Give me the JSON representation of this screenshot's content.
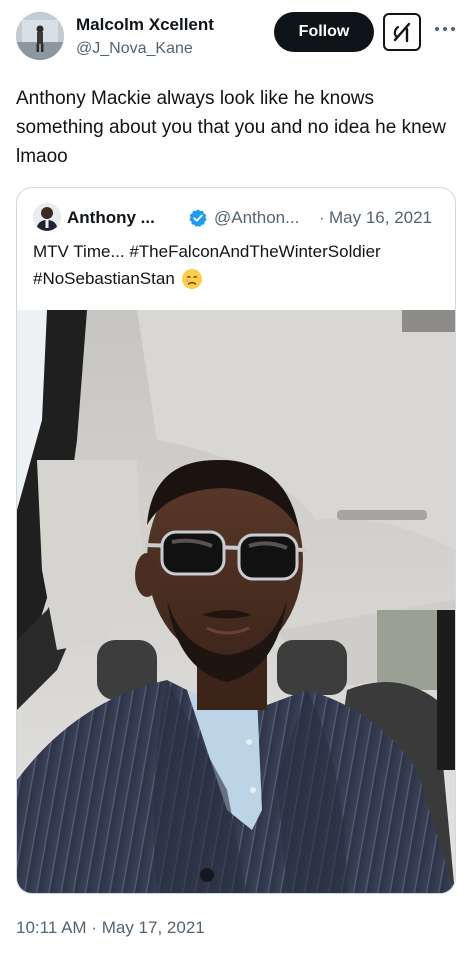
{
  "tweet": {
    "author": {
      "display_name": "Malcolm Xcellent",
      "handle": "@J_Nova_Kane"
    },
    "follow_label": "Follow",
    "text": "Anthony Mackie always look like he knows something about you that you and no idea he knew lmaoo",
    "timestamp": "10:11 AM",
    "separator": "·",
    "date": "May 17, 2021"
  },
  "quote": {
    "display_name": "Anthony ...",
    "handle": "@Anthon...",
    "separator": "·",
    "date": "May 16, 2021",
    "text_line1": "MTV Time... #TheFalconAndTheWinterSoldier",
    "text_line2": "#NoSebastianStan",
    "verified": true
  },
  "icons": {
    "grok": "grok-icon",
    "more": "more-icon",
    "verified": "verified-badge-icon",
    "emoji": "crying-face-emoji"
  },
  "colors": {
    "primary_text": "#0f1419",
    "secondary_text": "#536471",
    "border": "#cfd9de",
    "verified": "#1d9bf0",
    "follow_bg": "#0f1419"
  }
}
